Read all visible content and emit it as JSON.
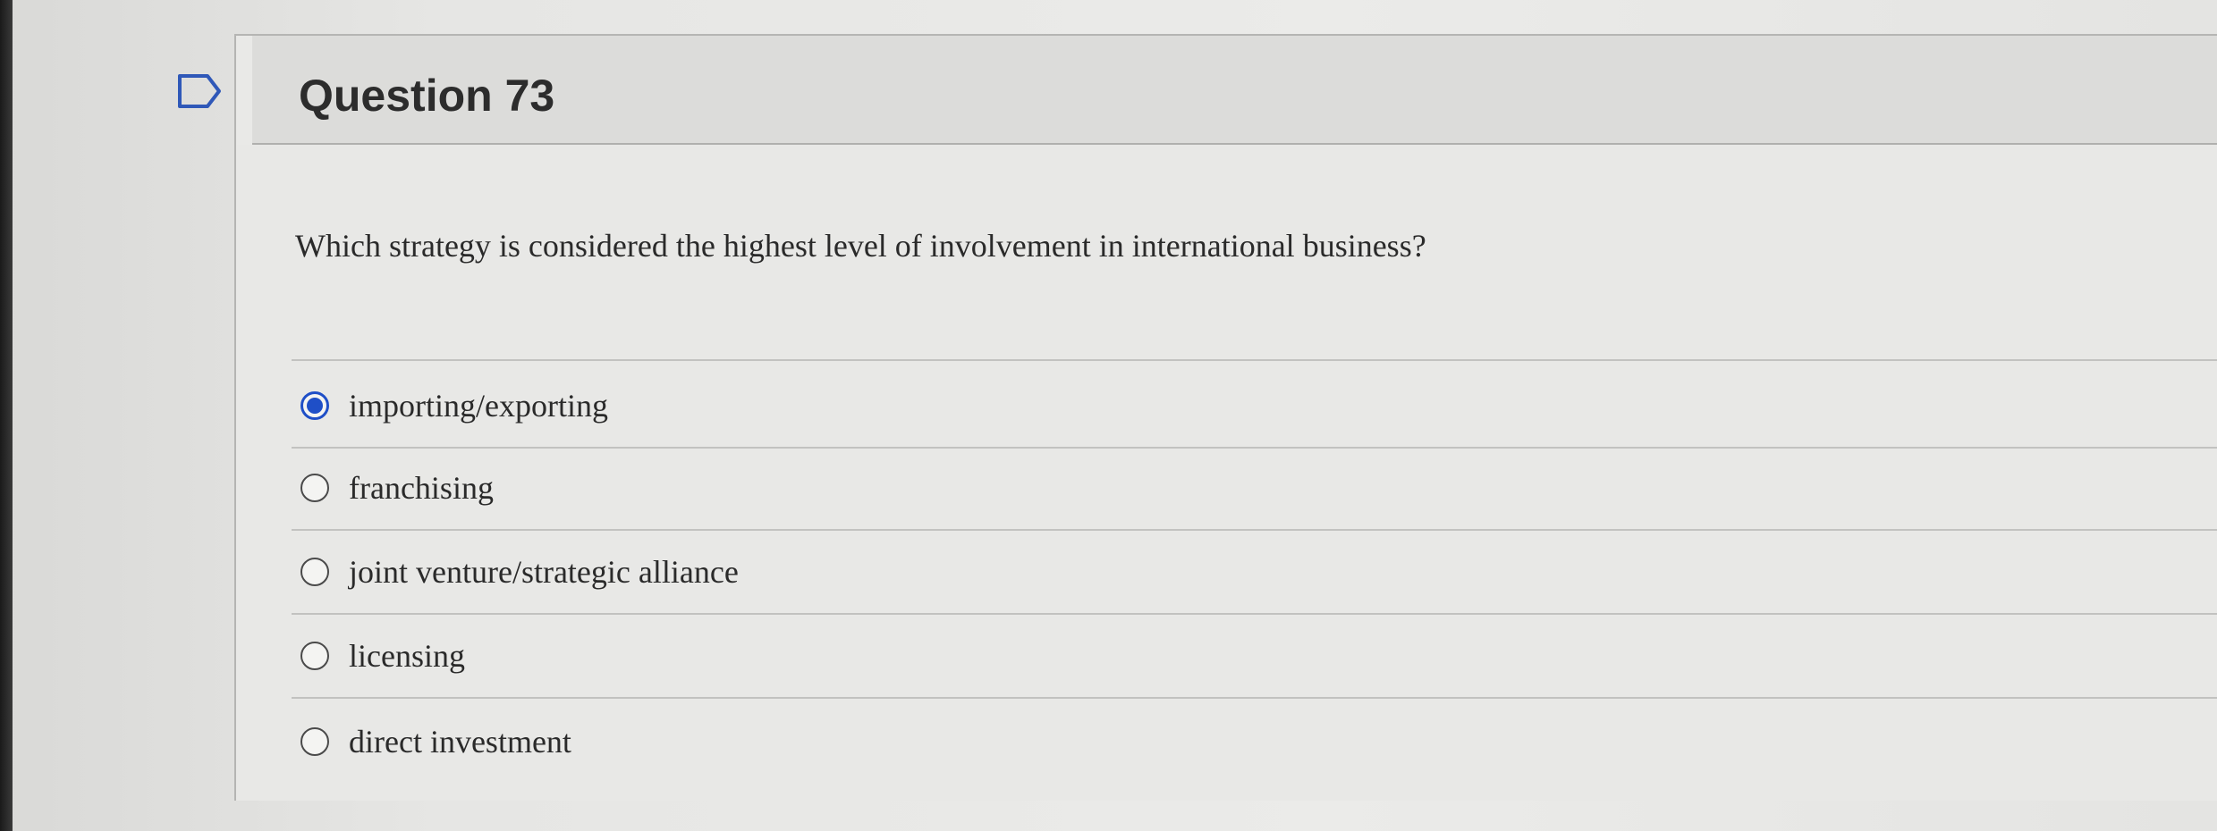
{
  "question": {
    "title": "Question 73",
    "text": "Which strategy is considered the highest level of involvement in international business?",
    "answers": [
      {
        "label": "importing/exporting",
        "selected": true
      },
      {
        "label": "franchising",
        "selected": false
      },
      {
        "label": "joint venture/strategic alliance",
        "selected": false
      },
      {
        "label": "licensing",
        "selected": false
      },
      {
        "label": "direct investment",
        "selected": false
      }
    ]
  },
  "colors": {
    "selected_radio": "#1f4fc7",
    "text": "#2a2a2a",
    "header_bg": "#dcdcda"
  }
}
